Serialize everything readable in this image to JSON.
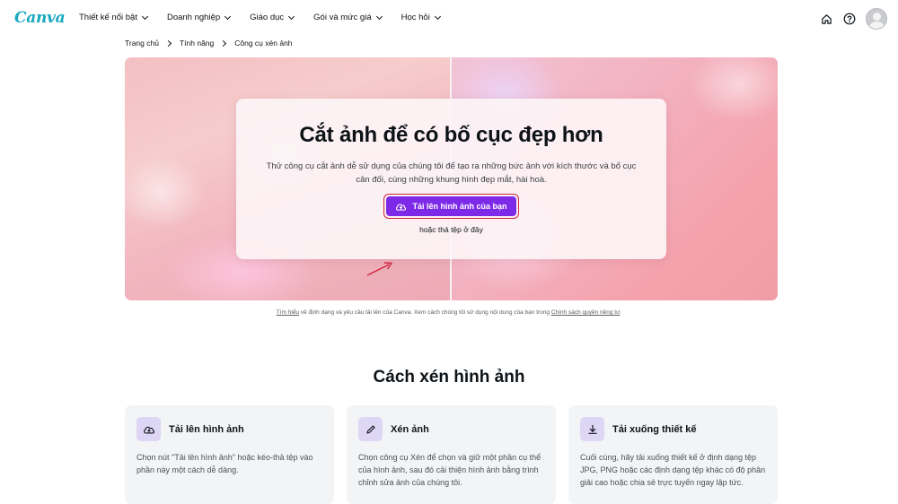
{
  "brand": {
    "logo_text": "Canva"
  },
  "nav": {
    "items": [
      {
        "label": "Thiết kế nổi bật"
      },
      {
        "label": "Doanh nghiệp"
      },
      {
        "label": "Giáo dục"
      },
      {
        "label": "Gói và mức giá"
      },
      {
        "label": "Học hỏi"
      }
    ],
    "right_icons": [
      "home-icon",
      "help-icon",
      "avatar"
    ]
  },
  "breadcrumb": [
    "Trang chủ",
    "Tính năng",
    "Công cụ xén ảnh"
  ],
  "hero": {
    "title": "Cắt ảnh để có bố cục đẹp hơn",
    "description": "Thử công cụ cắt ảnh dễ sử dụng của chúng tôi để tạo ra những bức ảnh với kích thước và bố cục cân đối, cùng những khung hình đẹp mắt, hài hoà.",
    "upload_button": "Tải lên hình ảnh của bạn",
    "drop_text": "hoặc thả tệp ở đây"
  },
  "notice": {
    "link1": "Tìm hiểu",
    "middle": " về định dạng và yêu cầu tải lên của Canva. Xem cách chúng tôi sử dụng nội dung của bạn trong ",
    "link2": "Chính sách quyền riêng tư",
    "end": "."
  },
  "how_to": {
    "title": "Cách xén hình ảnh",
    "steps": [
      {
        "icon": "upload-cloud-icon",
        "title": "Tải lên hình ảnh",
        "text": "Chọn nút \"Tải lên hình ảnh\" hoặc kéo-thả tệp vào phần này một cách dễ dàng."
      },
      {
        "icon": "pencil-icon",
        "title": "Xén ảnh",
        "text": "Chọn công cụ Xén để chọn và giữ một phần cụ thể của hình ảnh, sau đó cải thiện hình ảnh bằng trình chỉnh sửa ảnh của chúng tôi."
      },
      {
        "icon": "download-icon",
        "title": "Tải xuống thiết kế",
        "text": "Cuối cùng, hãy tải xuống thiết kế ở định dạng tệp JPG, PNG hoặc các định dạng tệp khác có độ phân giải cao hoặc chia sẻ trực tuyến ngay lập tức."
      }
    ]
  },
  "colors": {
    "brand": "#7d2ae8",
    "logo": "#17a7c0",
    "highlight": "#d0243c",
    "icon_bg": "#ddd6f5"
  }
}
